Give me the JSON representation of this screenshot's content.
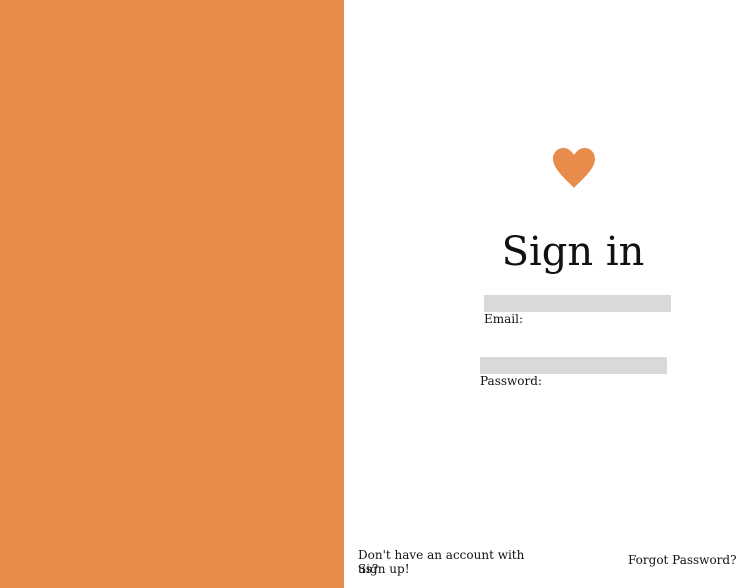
{
  "colors": {
    "accent": "#e88c4c",
    "input_bg": "#d9d9d9",
    "text": "#111111"
  },
  "side_panel": {
    "icon": "none"
  },
  "logo": {
    "icon": "heart-icon"
  },
  "title": "Sign in",
  "form": {
    "email": {
      "label": "Email:",
      "value": "",
      "placeholder": ""
    },
    "password": {
      "label": "Password:",
      "value": "",
      "placeholder": ""
    }
  },
  "footer": {
    "signup_prompt": "Don't have an account with us?",
    "signup_link": "Sign up!",
    "forgot_link": "Forgot Password?"
  }
}
